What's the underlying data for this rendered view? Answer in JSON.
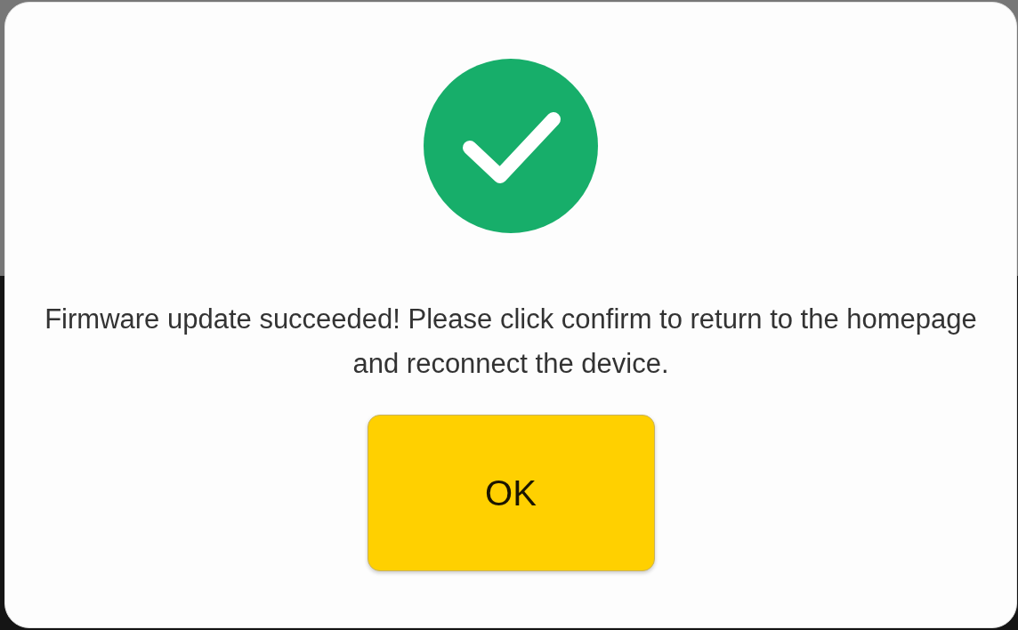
{
  "dialog": {
    "success": true,
    "message": "Firmware update succeeded! Please click confirm to return to the homepage and reconnect the device.",
    "button": "OK"
  }
}
